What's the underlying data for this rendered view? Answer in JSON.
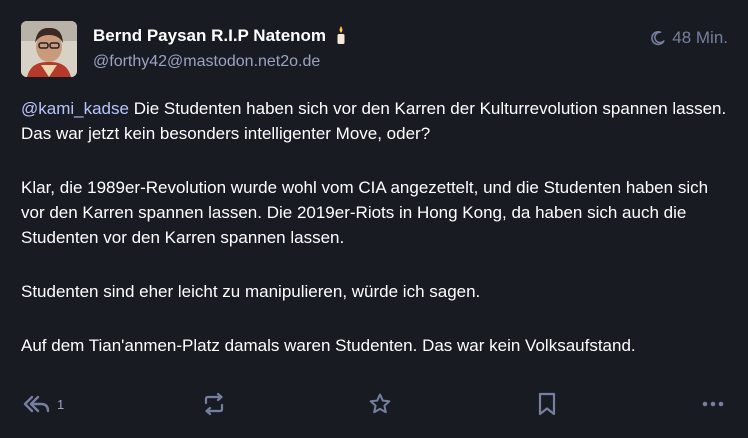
{
  "post": {
    "display_name": "Bernd Paysan R.I.P Natenom",
    "emoji": "candle-emoji",
    "handle": "@forthy42@mastodon.net2o.de",
    "time": "48 Min.",
    "mention": "@kami_kadse",
    "paragraphs": [
      " Die Studenten haben sich vor den Karren der Kulturrevolution spannen lassen. Das war jetzt kein besonders intelligenter Move, oder?",
      "Klar, die 1989er-Revolution wurde wohl vom CIA angezettelt, und die Studenten haben sich vor den Karren spannen lassen. Die 2019er-Riots in Hong Kong, da haben sich auch die Studenten vor den Karren spannen lassen.",
      "Studenten sind eher leicht zu manipulieren, würde ich sagen.",
      "Auf dem Tian'anmen-Platz damals waren Studenten. Das war kein Volksaufstand."
    ]
  },
  "actions": {
    "reply_icon": "reply-all-icon",
    "reply_count": "1",
    "boost_icon": "boost-icon",
    "favourite_icon": "star-icon",
    "bookmark_icon": "bookmark-icon",
    "more_icon": "more-horizontal-icon"
  },
  "colors": {
    "background": "#191b22",
    "text": "#ffffff",
    "mention": "#b8c4ff",
    "secondary": "#9aa3c2",
    "icon": "#757f9e"
  }
}
